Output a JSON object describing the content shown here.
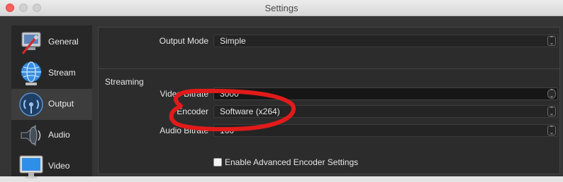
{
  "window": {
    "title": "Settings"
  },
  "sidebar": {
    "items": [
      {
        "label": "General",
        "icon": "general-icon"
      },
      {
        "label": "Stream",
        "icon": "stream-globe-icon"
      },
      {
        "label": "Output",
        "icon": "output-icon"
      },
      {
        "label": "Audio",
        "icon": "speaker-icon"
      },
      {
        "label": "Video",
        "icon": "monitor-icon"
      }
    ],
    "active": "Output"
  },
  "output": {
    "mode_label": "Output Mode",
    "mode_value": "Simple"
  },
  "streaming": {
    "group_title": "Streaming",
    "video_bitrate_label": "Video Bitrate",
    "video_bitrate_value": "3000",
    "encoder_label": "Encoder",
    "encoder_value": "Software (x264)",
    "audio_bitrate_label": "Audio Bitrate",
    "audio_bitrate_value": "160",
    "advanced_checkbox_label": "Enable Advanced Encoder Settings",
    "advanced_checked": false
  },
  "colors": {
    "background": "#353535",
    "panel": "#2c2c2c",
    "sidebar": "#272727",
    "annotation_red": "#e11a1a"
  }
}
